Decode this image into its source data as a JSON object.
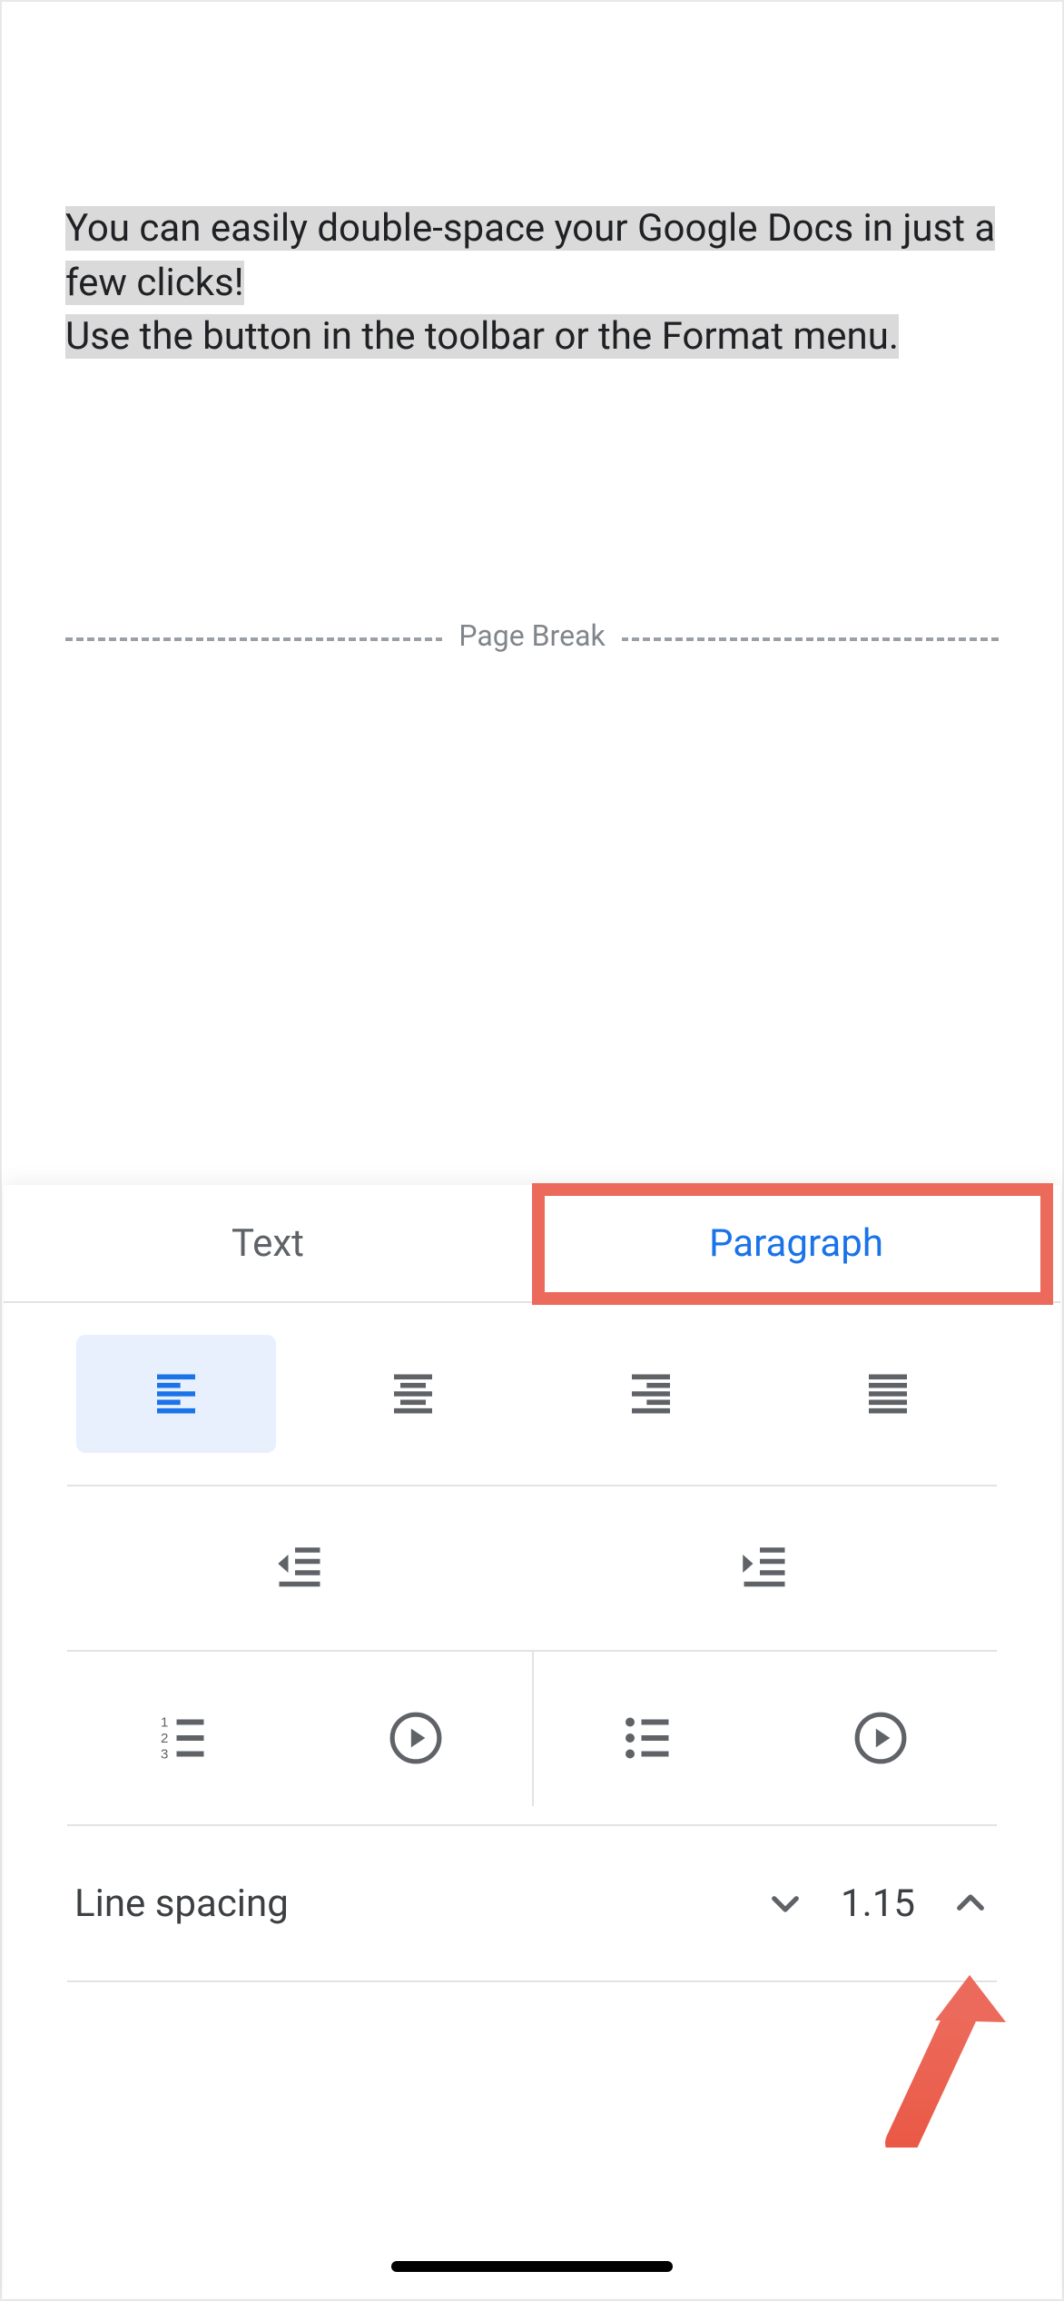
{
  "document": {
    "line1": "You can easily double-space your Google Docs in just a few clicks!",
    "line2": "Use the button in the toolbar or the Format menu.",
    "page_break_label": "Page Break"
  },
  "tabs": {
    "text": "Text",
    "paragraph": "Paragraph"
  },
  "line_spacing": {
    "label": "Line spacing",
    "value": "1.15"
  }
}
